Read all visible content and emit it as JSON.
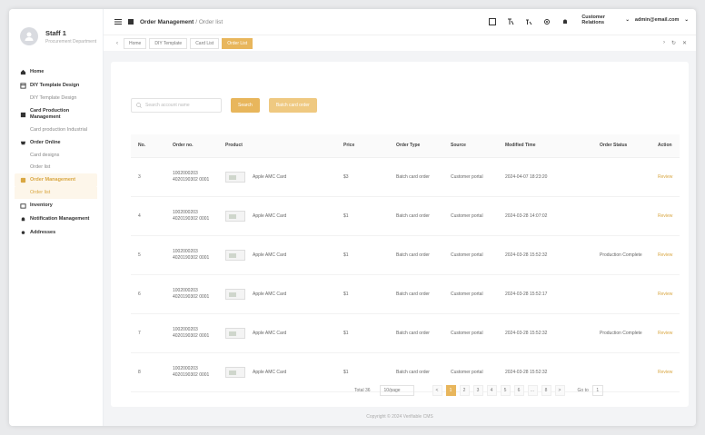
{
  "user": {
    "name": "Staff 1",
    "department": "Procurement Department"
  },
  "sidebar": {
    "groups": [
      {
        "label": "Home",
        "icon": "home-icon",
        "subs": []
      },
      {
        "label": "DIY Template Design",
        "icon": "template-icon",
        "subs": [
          "DIY Template Design"
        ]
      },
      {
        "label": "Card Production Management",
        "icon": "card-icon",
        "subs": [
          "Card production Industrial"
        ]
      },
      {
        "label": "Order Online",
        "icon": "cart-icon",
        "subs": [
          "Card designs",
          "Order list"
        ]
      },
      {
        "label": "Order Management",
        "icon": "orders-icon",
        "subs": [
          "Order list"
        ],
        "active": true
      },
      {
        "label": "Inventory",
        "icon": "inventory-icon",
        "subs": []
      },
      {
        "label": "Notification Management",
        "icon": "bell-icon",
        "subs": []
      },
      {
        "label": "Addresses",
        "icon": "location-icon",
        "subs": []
      }
    ]
  },
  "topbar": {
    "breadcrumb_main": "Order Management",
    "breadcrumb_sub": "/ Order list",
    "role": "Customer Relations",
    "email": "admin@email.com"
  },
  "tabs": [
    "Home",
    "DIY Template",
    "Card List",
    "Order List"
  ],
  "search": {
    "placeholder": "Search account name",
    "search_label": "Search",
    "batch_label": "Batch card order"
  },
  "table": {
    "headers": [
      "No.",
      "Order no.",
      "Product",
      "Price",
      "Order Type",
      "Source",
      "Modified Time",
      "Order Status",
      "Action"
    ],
    "rows": [
      {
        "no": "3",
        "order": "1002000203 4020190302 0001",
        "product": "Apple AMC Card",
        "price": "$3",
        "type": "Batch card order",
        "source": "Customer portal",
        "time": "2024-04-07 18:23:20",
        "status": "",
        "action": "Review"
      },
      {
        "no": "4",
        "order": "1002000203 4020190302 0001",
        "product": "Apple AMC Card",
        "price": "$1",
        "type": "Batch card order",
        "source": "Customer portal",
        "time": "2024-03-28 14:07:02",
        "status": "",
        "action": "Review"
      },
      {
        "no": "5",
        "order": "1002000203 4020190302 0001",
        "product": "Apple AMC Card",
        "price": "$1",
        "type": "Batch card order",
        "source": "Customer portal",
        "time": "2024-03-28 15:52:32",
        "status": "Production Complete",
        "action": "Review"
      },
      {
        "no": "6",
        "order": "1002000203 4020190302 0001",
        "product": "Apple AMC Card",
        "price": "$1",
        "type": "Batch card order",
        "source": "Customer portal",
        "time": "2024-03-28 15:52:17",
        "status": "",
        "action": "Review"
      },
      {
        "no": "7",
        "order": "1002000203 4020190302 0001",
        "product": "Apple AMC Card",
        "price": "$1",
        "type": "Batch card order",
        "source": "Customer portal",
        "time": "2024-03-28 15:52:32",
        "status": "Production Complete",
        "action": "Review"
      },
      {
        "no": "8",
        "order": "1002000203 4020190302 0001",
        "product": "Apple AMC Card",
        "price": "$1",
        "type": "Batch card order",
        "source": "Customer portal",
        "time": "2024-03-28 15:52:32",
        "status": "",
        "action": "Review"
      }
    ]
  },
  "pager": {
    "total": "Total 36",
    "size": "10/page",
    "pages": [
      "<",
      "1",
      "2",
      "3",
      "4",
      "5",
      "6",
      "...",
      "8",
      ">"
    ],
    "goto_label": "Go to",
    "goto_value": "1"
  },
  "footer": "Copyright © 2024 Verifiable CMS"
}
